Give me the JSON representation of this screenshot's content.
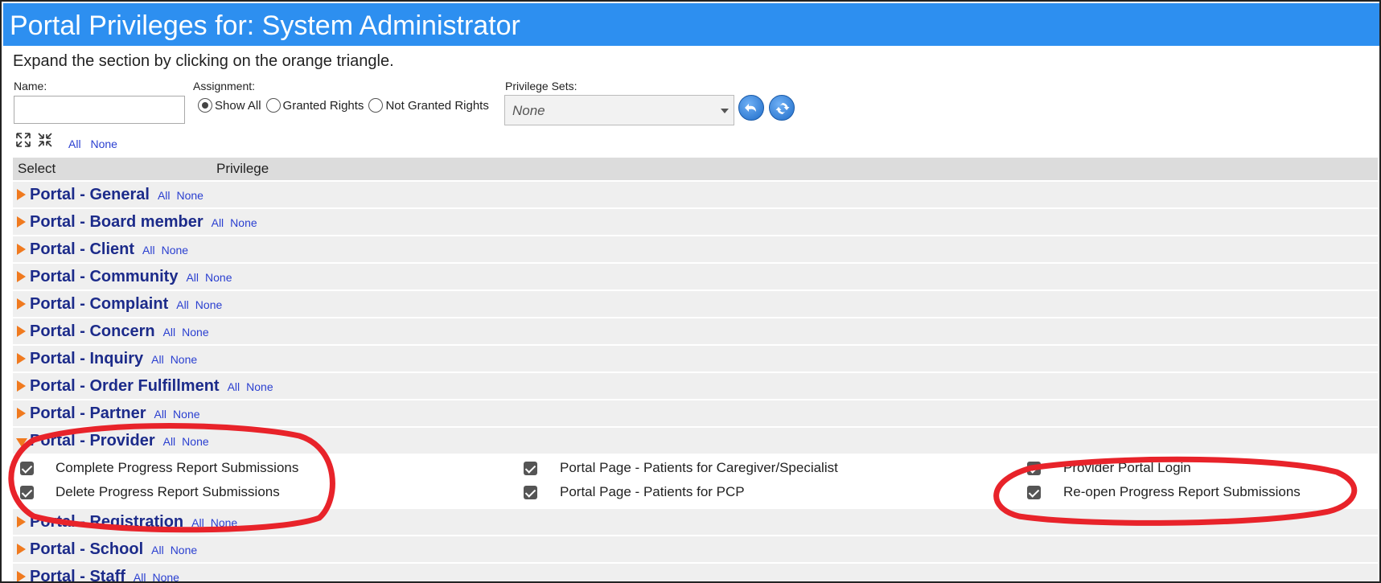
{
  "title": "Portal Privileges for: System Administrator",
  "instructions": "Expand the section by clicking on the orange triangle.",
  "filters": {
    "name_label": "Name:",
    "name_value": "",
    "assignment_label": "Assignment:",
    "assignment_options": [
      "Show All",
      "Granted Rights",
      "Not Granted Rights"
    ],
    "assignment_selected": "Show All",
    "privilege_sets_label": "Privilege Sets:",
    "privilege_sets_value": "None"
  },
  "toolbar": {
    "all_label": "All",
    "none_label": "None"
  },
  "table_header": {
    "select": "Select",
    "privilege": "Privilege"
  },
  "groups": [
    {
      "name": "Portal - General",
      "all": "All",
      "none": "None",
      "expanded": false
    },
    {
      "name": "Portal - Board member",
      "all": "All",
      "none": "None",
      "expanded": false
    },
    {
      "name": "Portal - Client",
      "all": "All",
      "none": "None",
      "expanded": false
    },
    {
      "name": "Portal - Community",
      "all": "All",
      "none": "None",
      "expanded": false
    },
    {
      "name": "Portal - Complaint",
      "all": "All",
      "none": "None",
      "expanded": false
    },
    {
      "name": "Portal - Concern",
      "all": "All",
      "none": "None",
      "expanded": false
    },
    {
      "name": "Portal - Inquiry",
      "all": "All",
      "none": "None",
      "expanded": false
    },
    {
      "name": "Portal - Order Fulfillment",
      "all": "All",
      "none": "None",
      "expanded": false
    },
    {
      "name": "Portal - Partner",
      "all": "All",
      "none": "None",
      "expanded": false
    },
    {
      "name": "Portal - Provider",
      "all": "All",
      "none": "None",
      "expanded": true
    },
    {
      "name": "Portal - Registration",
      "all": "All",
      "none": "None",
      "expanded": false
    },
    {
      "name": "Portal - School",
      "all": "All",
      "none": "None",
      "expanded": false
    },
    {
      "name": "Portal - Staff",
      "all": "All",
      "none": "None",
      "expanded": false
    }
  ],
  "provider_privileges": [
    {
      "label": "Complete Progress Report Submissions",
      "checked": true
    },
    {
      "label": "Delete Progress Report Submissions",
      "checked": true
    },
    {
      "label": "Portal Page - Patients for Caregiver/Specialist",
      "checked": true
    },
    {
      "label": "Portal Page - Patients for PCP",
      "checked": true
    },
    {
      "label": "Provider Portal Login",
      "checked": true
    },
    {
      "label": "Re-open Progress Report Submissions",
      "checked": true
    }
  ],
  "colors": {
    "title_bar": "#2d8ff0",
    "group_text": "#1c2b8a",
    "link": "#2a3fd0",
    "triangle": "#f07a1f",
    "annotation": "#e8232a"
  }
}
